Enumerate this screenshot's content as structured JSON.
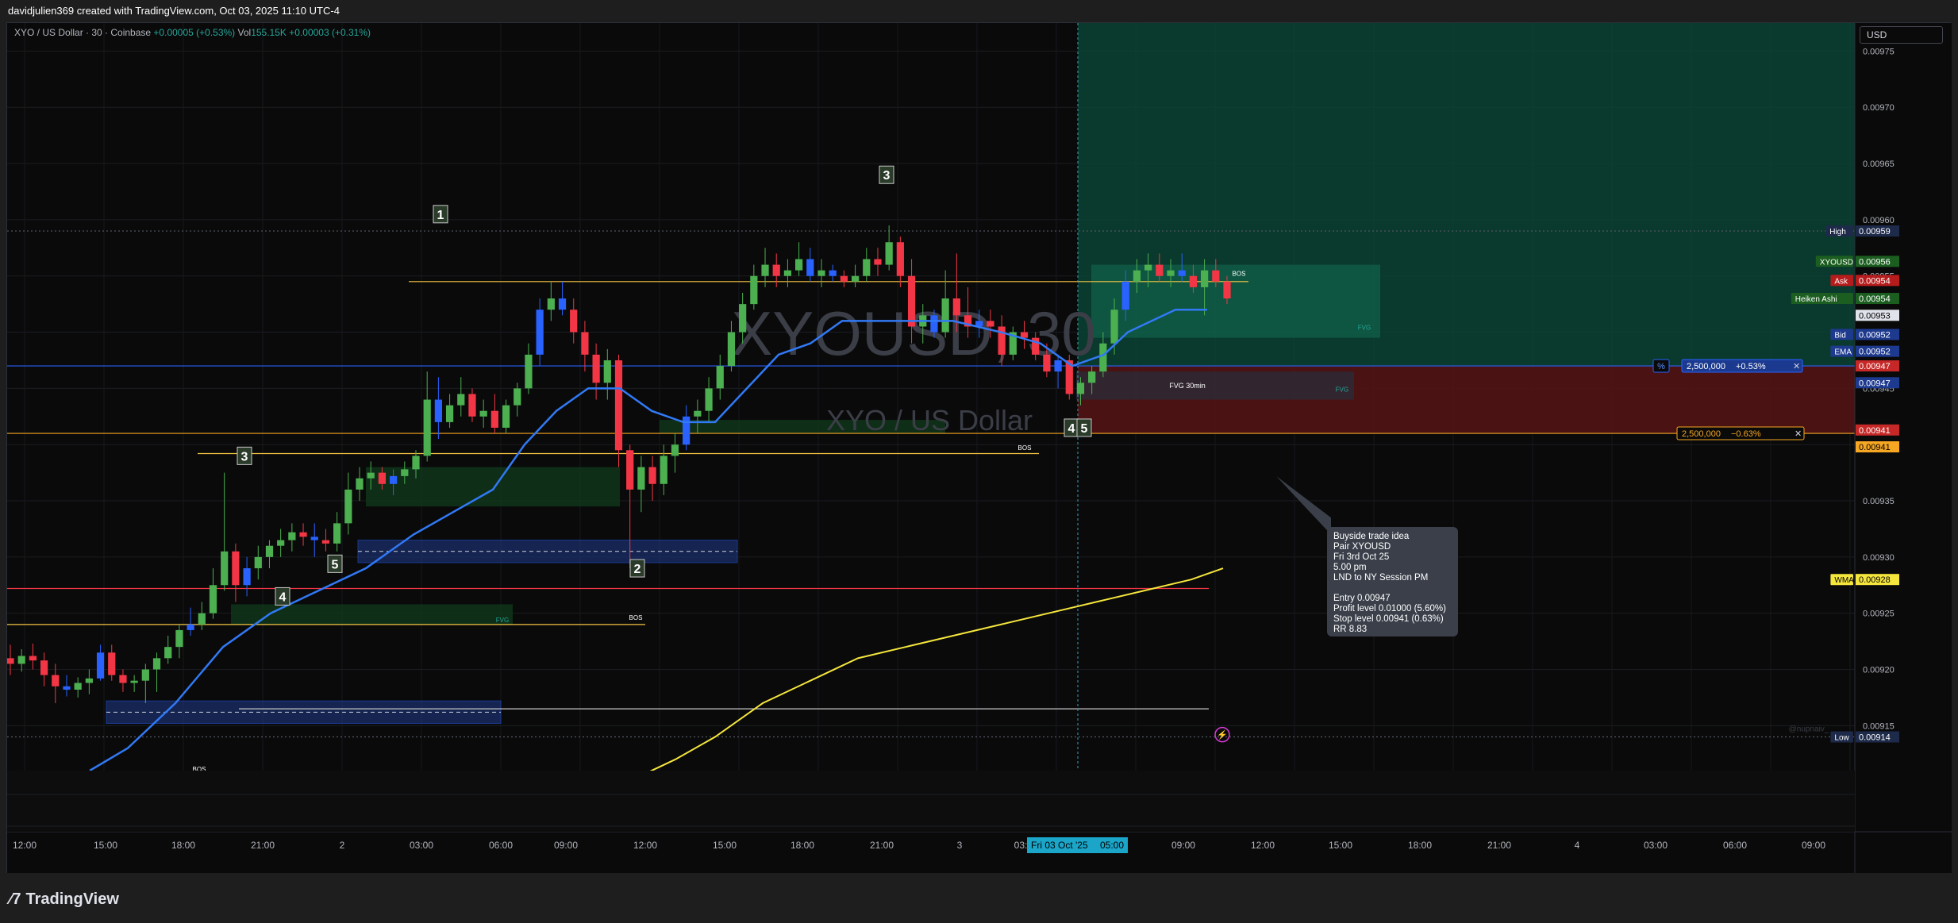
{
  "header": {
    "created_by": "davidjulien369 created with TradingView.com, Oct 03, 2025 11:10 UTC-4"
  },
  "legend": {
    "symbol": "XYO / US Dollar · 30 · Coinbase",
    "change": "+0.00005 (+0.53%)",
    "vol_label": "Vol",
    "vol_value": "155.15K",
    "vol_change": "+0.00003 (+0.31%)"
  },
  "currency_button": "USD",
  "watermark": {
    "ticker": "XYOUSD, 30",
    "name": "XYO / US Dollar"
  },
  "note": {
    "lines": [
      "Buyside trade idea",
      "Pair XYOUSD",
      "Fri 3rd Oct 25",
      "5.00 pm",
      "LND to NY Session PM",
      "",
      "Entry 0.00947",
      "Profit level 0.01000 (5.60%)",
      "Stop level 0.00941 (0.63%)",
      "RR 8.83"
    ]
  },
  "position": {
    "qty_label": "2,500,000",
    "profit_pct": "+0.53%",
    "stop_pct": "−0.63%",
    "pct_button": "%",
    "close_symbol": "✕"
  },
  "footer": {
    "brand": "TradingView"
  },
  "colors": {
    "background": "#0a0a0a",
    "up": "#26a69a",
    "up_candle": "#4caf50",
    "down_candle": "#f23645",
    "ha_blue": "#2962ff",
    "ema": "#3179f5",
    "wma": "#f5e63d",
    "target_zone": "#0b4a3a",
    "stop_zone": "#5a1414",
    "entry_line": "#2962ff"
  },
  "chart_data": {
    "type": "candlestick",
    "symbol": "XYOUSD",
    "interval": "30",
    "exchange": "Coinbase",
    "y_axis": {
      "range": [
        0.00911,
        0.009775
      ],
      "ticks": [
        "0.00915",
        "0.00920",
        "0.00925",
        "0.00930",
        "0.00935",
        "0.00940",
        "0.00945",
        "0.00950",
        "0.00955",
        "0.00960",
        "0.00965",
        "0.00970",
        "0.00975"
      ]
    },
    "x_axis": {
      "labels": [
        "12:00",
        "15:00",
        "18:00",
        "21:00",
        "2",
        "03:00",
        "06:00",
        "09:00",
        "12:00",
        "15:00",
        "18:00",
        "21:00",
        "3",
        "03:",
        "05:00",
        "09:00",
        "12:00",
        "15:00",
        "18:00",
        "21:00",
        "4",
        "03:00",
        "06:00",
        "09:00"
      ],
      "crosshair_label": "Fri 03 Oct '25"
    },
    "price_labels": [
      {
        "name": "High",
        "value": "0.00959"
      },
      {
        "name": "XYOUSD",
        "value": "0.00956"
      },
      {
        "name": "Ask",
        "value": "0.00954"
      },
      {
        "name": "Heiken Ashi",
        "value": "0.00954"
      },
      {
        "name": "",
        "value": "0.00953"
      },
      {
        "name": "Bid",
        "value": "0.00952"
      },
      {
        "name": "EMA",
        "value": "0.00952"
      },
      {
        "name": "",
        "value": "0.00947"
      },
      {
        "name": "",
        "value": "0.00947"
      },
      {
        "name": "",
        "value": "0.00941"
      },
      {
        "name": "",
        "value": "0.00941"
      },
      {
        "name": "WMA",
        "value": "0.00928"
      },
      {
        "name": "Low",
        "value": "0.00914"
      }
    ],
    "candles": [
      [
        0.00921,
        0.009222,
        0.009195,
        0.009205
      ],
      [
        0.009205,
        0.009218,
        0.009198,
        0.009212
      ],
      [
        0.009212,
        0.009223,
        0.0092,
        0.009208
      ],
      [
        0.009208,
        0.009215,
        0.009185,
        0.009195
      ],
      [
        0.009195,
        0.009205,
        0.00917,
        0.009185
      ],
      [
        0.009185,
        0.009195,
        0.009176,
        0.009182
      ],
      [
        0.009182,
        0.009193,
        0.009175,
        0.009188
      ],
      [
        0.009188,
        0.0092,
        0.009178,
        0.009192
      ],
      [
        0.009192,
        0.009222,
        0.00919,
        0.009215
      ],
      [
        0.009215,
        0.009222,
        0.00919,
        0.009195
      ],
      [
        0.009195,
        0.0092,
        0.00918,
        0.009188
      ],
      [
        0.009188,
        0.009195,
        0.00918,
        0.00919
      ],
      [
        0.00919,
        0.009205,
        0.00917,
        0.0092
      ],
      [
        0.0092,
        0.009215,
        0.00918,
        0.00921
      ],
      [
        0.00921,
        0.00923,
        0.009205,
        0.00922
      ],
      [
        0.00922,
        0.00924,
        0.00921,
        0.009235
      ],
      [
        0.009235,
        0.009255,
        0.00923,
        0.00924
      ],
      [
        0.00924,
        0.00926,
        0.009235,
        0.00925
      ],
      [
        0.00925,
        0.00929,
        0.009245,
        0.009275
      ],
      [
        0.009275,
        0.009375,
        0.00927,
        0.009305
      ],
      [
        0.009305,
        0.009312,
        0.00926,
        0.009275
      ],
      [
        0.009275,
        0.0093,
        0.009265,
        0.00929
      ],
      [
        0.00929,
        0.00931,
        0.00928,
        0.0093
      ],
      [
        0.0093,
        0.009315,
        0.00929,
        0.00931
      ],
      [
        0.00931,
        0.009325,
        0.0093,
        0.009315
      ],
      [
        0.009315,
        0.00933,
        0.009305,
        0.009322
      ],
      [
        0.009322,
        0.00933,
        0.00931,
        0.009318
      ],
      [
        0.009318,
        0.00933,
        0.0093,
        0.009315
      ],
      [
        0.009315,
        0.009325,
        0.009305,
        0.009312
      ],
      [
        0.009312,
        0.00934,
        0.009305,
        0.00933
      ],
      [
        0.00933,
        0.009375,
        0.00932,
        0.00936
      ],
      [
        0.00936,
        0.00938,
        0.00935,
        0.00937
      ],
      [
        0.00937,
        0.009385,
        0.00936,
        0.009375
      ],
      [
        0.009375,
        0.00938,
        0.00936,
        0.009365
      ],
      [
        0.009365,
        0.009378,
        0.009355,
        0.009372
      ],
      [
        0.009372,
        0.009385,
        0.009365,
        0.009378
      ],
      [
        0.009378,
        0.009395,
        0.00937,
        0.00939
      ],
      [
        0.00939,
        0.009465,
        0.009385,
        0.00944
      ],
      [
        0.00944,
        0.00946,
        0.009405,
        0.00942
      ],
      [
        0.00942,
        0.009445,
        0.009415,
        0.009435
      ],
      [
        0.009435,
        0.00946,
        0.009425,
        0.009445
      ],
      [
        0.009445,
        0.00945,
        0.00942,
        0.009425
      ],
      [
        0.009425,
        0.00944,
        0.009415,
        0.00943
      ],
      [
        0.00943,
        0.009445,
        0.00941,
        0.009415
      ],
      [
        0.009415,
        0.00944,
        0.00941,
        0.009435
      ],
      [
        0.009435,
        0.009455,
        0.009425,
        0.00945
      ],
      [
        0.00945,
        0.00949,
        0.009445,
        0.00948
      ],
      [
        0.00948,
        0.00953,
        0.00947,
        0.00952
      ],
      [
        0.00952,
        0.009545,
        0.00951,
        0.00953
      ],
      [
        0.00953,
        0.009545,
        0.009515,
        0.00952
      ],
      [
        0.00952,
        0.00953,
        0.00949,
        0.0095
      ],
      [
        0.0095,
        0.00951,
        0.009465,
        0.00948
      ],
      [
        0.00948,
        0.00949,
        0.00944,
        0.009455
      ],
      [
        0.009455,
        0.009485,
        0.00944,
        0.009475
      ],
      [
        0.009475,
        0.00948,
        0.00938,
        0.009395
      ],
      [
        0.009395,
        0.0094,
        0.00929,
        0.00936
      ],
      [
        0.00936,
        0.00939,
        0.00934,
        0.00938
      ],
      [
        0.00938,
        0.00939,
        0.00935,
        0.009365
      ],
      [
        0.009365,
        0.0094,
        0.009355,
        0.00939
      ],
      [
        0.00939,
        0.00941,
        0.009375,
        0.0094
      ],
      [
        0.0094,
        0.009435,
        0.009395,
        0.009425
      ],
      [
        0.009425,
        0.00944,
        0.00941,
        0.00943
      ],
      [
        0.00943,
        0.00946,
        0.00942,
        0.00945
      ],
      [
        0.00945,
        0.00948,
        0.00944,
        0.00947
      ],
      [
        0.00947,
        0.00951,
        0.009465,
        0.0095
      ],
      [
        0.0095,
        0.009535,
        0.00949,
        0.009525
      ],
      [
        0.009525,
        0.00956,
        0.00952,
        0.00955
      ],
      [
        0.00955,
        0.009575,
        0.00954,
        0.00956
      ],
      [
        0.00956,
        0.00957,
        0.00954,
        0.00955
      ],
      [
        0.00955,
        0.009565,
        0.00954,
        0.009555
      ],
      [
        0.009555,
        0.00958,
        0.00955,
        0.009565
      ],
      [
        0.009565,
        0.009575,
        0.009545,
        0.00955
      ],
      [
        0.00955,
        0.009565,
        0.00954,
        0.009555
      ],
      [
        0.009555,
        0.00956,
        0.009545,
        0.00955
      ],
      [
        0.00955,
        0.009555,
        0.00954,
        0.009545
      ],
      [
        0.009545,
        0.00956,
        0.00954,
        0.00955
      ],
      [
        0.00955,
        0.009575,
        0.009545,
        0.009565
      ],
      [
        0.009565,
        0.009575,
        0.00955,
        0.00956
      ],
      [
        0.00956,
        0.009595,
        0.009555,
        0.00958
      ],
      [
        0.00958,
        0.009585,
        0.00954,
        0.00955
      ],
      [
        0.00955,
        0.009565,
        0.00949,
        0.009505
      ],
      [
        0.009505,
        0.009525,
        0.00949,
        0.009515
      ],
      [
        0.009515,
        0.00952,
        0.009495,
        0.0095
      ],
      [
        0.0095,
        0.009555,
        0.009495,
        0.00953
      ],
      [
        0.00953,
        0.00957,
        0.0095,
        0.009515
      ],
      [
        0.009515,
        0.00954,
        0.009495,
        0.009505
      ],
      [
        0.009505,
        0.00952,
        0.009495,
        0.00951
      ],
      [
        0.00951,
        0.00952,
        0.009495,
        0.009505
      ],
      [
        0.009505,
        0.009515,
        0.00947,
        0.00948
      ],
      [
        0.00948,
        0.009505,
        0.009475,
        0.0095
      ],
      [
        0.0095,
        0.00951,
        0.009485,
        0.009495
      ],
      [
        0.009495,
        0.0095,
        0.009475,
        0.00948
      ],
      [
        0.00948,
        0.00949,
        0.00946,
        0.009465
      ],
      [
        0.009465,
        0.00948,
        0.00945,
        0.009475
      ],
      [
        0.009475,
        0.00948,
        0.00944,
        0.009445
      ],
      [
        0.009445,
        0.00946,
        0.009435,
        0.009455
      ],
      [
        0.009455,
        0.00947,
        0.009445,
        0.009465
      ],
      [
        0.009465,
        0.0095,
        0.00946,
        0.00949
      ],
      [
        0.00949,
        0.00953,
        0.00948,
        0.00952
      ],
      [
        0.00952,
        0.009555,
        0.00951,
        0.009545
      ],
      [
        0.009545,
        0.009565,
        0.009535,
        0.009555
      ],
      [
        0.009555,
        0.00957,
        0.00954,
        0.00956
      ],
      [
        0.00956,
        0.00957,
        0.009545,
        0.00955
      ],
      [
        0.00955,
        0.009565,
        0.00954,
        0.009555
      ],
      [
        0.009555,
        0.00957,
        0.009545,
        0.00955
      ],
      [
        0.00955,
        0.00956,
        0.009535,
        0.00954
      ],
      [
        0.00954,
        0.009565,
        0.009515,
        0.009555
      ],
      [
        0.009555,
        0.009565,
        0.00954,
        0.009545
      ],
      [
        0.009545,
        0.00955,
        0.009525,
        0.00953
      ]
    ],
    "ema_points": [
      [
        112,
        0.00911
      ],
      [
        160,
        0.00913
      ],
      [
        220,
        0.00917
      ],
      [
        280,
        0.00922
      ],
      [
        340,
        0.00925
      ],
      [
        400,
        0.00927
      ],
      [
        460,
        0.00929
      ],
      [
        520,
        0.00932
      ],
      [
        570,
        0.00934
      ],
      [
        620,
        0.00936
      ],
      [
        660,
        0.0094
      ],
      [
        700,
        0.00943
      ],
      [
        740,
        0.00945
      ],
      [
        780,
        0.00945
      ],
      [
        820,
        0.00943
      ],
      [
        860,
        0.00942
      ],
      [
        900,
        0.00942
      ],
      [
        940,
        0.00945
      ],
      [
        980,
        0.00948
      ],
      [
        1020,
        0.00949
      ],
      [
        1060,
        0.00951
      ],
      [
        1100,
        0.00951
      ],
      [
        1140,
        0.00951
      ],
      [
        1200,
        0.00951
      ],
      [
        1260,
        0.0095
      ],
      [
        1310,
        0.00949
      ],
      [
        1350,
        0.00947
      ],
      [
        1390,
        0.00948
      ],
      [
        1420,
        0.0095
      ],
      [
        1450,
        0.00951
      ],
      [
        1480,
        0.00952
      ],
      [
        1520,
        0.00952
      ]
    ],
    "wma_points": [
      [
        790,
        0.0091
      ],
      [
        850,
        0.00912
      ],
      [
        900,
        0.00914
      ],
      [
        960,
        0.00917
      ],
      [
        1020,
        0.00919
      ],
      [
        1080,
        0.00921
      ],
      [
        1140,
        0.00922
      ],
      [
        1200,
        0.00923
      ],
      [
        1260,
        0.00924
      ],
      [
        1320,
        0.00925
      ],
      [
        1380,
        0.00926
      ],
      [
        1440,
        0.00927
      ],
      [
        1500,
        0.00928
      ],
      [
        1540,
        0.00929
      ]
    ],
    "numbered_labels": [
      {
        "text": "1",
        "x": 0.554,
        "y": 0.009605
      },
      {
        "text": "2",
        "x": 0.802,
        "y": 0.00929
      },
      {
        "text": "3",
        "x": 1.116,
        "y": 0.00964
      },
      {
        "text": "3",
        "x": 0.307,
        "y": 0.00939
      },
      {
        "text": "4",
        "x": 0.355,
        "y": 0.009265
      },
      {
        "text": "5",
        "x": 0.421,
        "y": 0.009294
      },
      {
        "text": "4",
        "x": 1.349,
        "y": 0.009415
      },
      {
        "text": "5",
        "x": 1.365,
        "y": 0.009415
      }
    ],
    "annotations": [
      {
        "text": "BOS",
        "kind": "bos"
      },
      {
        "text": "BOS",
        "kind": "bos"
      },
      {
        "text": "BOS",
        "kind": "bos"
      },
      {
        "text": "BOS",
        "kind": "bos"
      },
      {
        "text": "FVG",
        "kind": "fvg"
      },
      {
        "text": "FVG",
        "kind": "fvg"
      },
      {
        "text": "FVG",
        "kind": "fvg"
      },
      {
        "text": "FVG 30min",
        "kind": "fvg-box"
      },
      {
        "text": "@nupnaiv_",
        "kind": "signature"
      }
    ],
    "position_tool": {
      "entry": 0.00947,
      "target": 0.01,
      "stop": 0.00941,
      "quantity": "2,500,000"
    }
  }
}
